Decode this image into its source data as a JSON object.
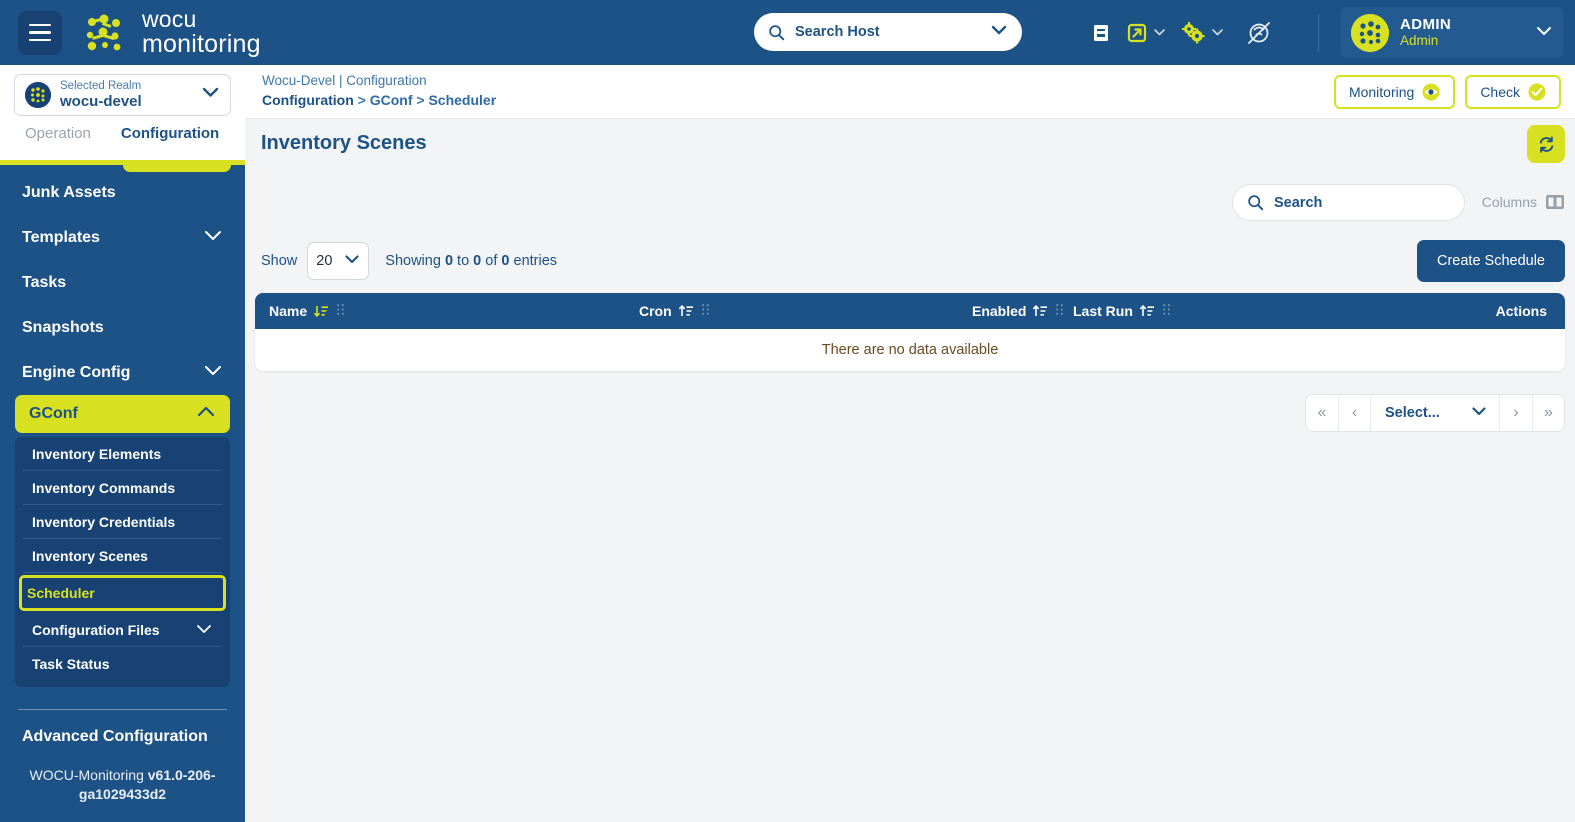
{
  "header": {
    "menu_icon": "hamburger-icon",
    "brand_line1": "wocu",
    "brand_line2": "monitoring",
    "search_host": {
      "placeholder": "Search Host",
      "value": "Search Host",
      "icon": "search-icon"
    },
    "icons": [
      {
        "name": "docs-icon",
        "label": "Documentation"
      },
      {
        "name": "external-link-icon",
        "label": "External Links"
      },
      {
        "name": "gears-icon",
        "label": "Settings"
      },
      {
        "name": "disabled-notifications-icon",
        "label": "Notifications Muted"
      }
    ],
    "user": {
      "name": "ADMIN",
      "role": "Admin",
      "avatar": "wocu-avatar-icon"
    }
  },
  "breadcrumb": {
    "context": "Wocu-Devel | Configuration",
    "path_root": "Configuration",
    "path_mid": "GConf",
    "path_leaf": "Scheduler",
    "separator": ">"
  },
  "top_actions": [
    {
      "label": "Monitoring",
      "icon": "eye-icon"
    },
    {
      "label": "Check",
      "icon": "check-circle-icon"
    }
  ],
  "sidebar": {
    "realm": {
      "caption": "Selected Realm",
      "value": "wocu-devel",
      "icon": "realm-icon"
    },
    "tabs": [
      {
        "label": "Operation",
        "active": false
      },
      {
        "label": "Configuration",
        "active": true
      }
    ],
    "items": [
      {
        "label": "Junk Assets",
        "expandable": false
      },
      {
        "label": "Templates",
        "expandable": true,
        "chevron": "chevron-down-icon"
      },
      {
        "label": "Tasks",
        "expandable": false
      },
      {
        "label": "Snapshots",
        "expandable": false
      },
      {
        "label": "Engine Config",
        "expandable": true,
        "chevron": "chevron-down-icon"
      },
      {
        "label": "GConf",
        "expandable": true,
        "active": true,
        "chevron": "chevron-up-icon"
      }
    ],
    "submenu": [
      {
        "label": "Inventory Elements",
        "selected": false
      },
      {
        "label": "Inventory Commands",
        "selected": false
      },
      {
        "label": "Inventory Credentials",
        "selected": false
      },
      {
        "label": "Inventory Scenes",
        "selected": false
      },
      {
        "label": "Scheduler",
        "selected": true
      },
      {
        "label": "Configuration Files",
        "selected": false,
        "expandable": true
      },
      {
        "label": "Task Status",
        "selected": false
      }
    ],
    "advanced_configuration": "Advanced Configuration",
    "version_prefix": "WOCU-Monitoring ",
    "version_number": "v61.0-206-ga1029433d2"
  },
  "main": {
    "page_title": "Inventory Scenes",
    "refresh_icon": "refresh-icon",
    "search": {
      "placeholder": "Search",
      "value": "Search",
      "icon": "search-icon"
    },
    "columns_label": "Columns",
    "columns_icon": "columns-icon",
    "show_label": "Show",
    "page_size": "20",
    "page_size_options": [
      "20"
    ],
    "showing_text_pre": "Showing ",
    "showing_from": "0",
    "showing_mid1": " to ",
    "showing_to": "0",
    "showing_mid2": " of ",
    "showing_total": "0",
    "showing_suffix": " entries",
    "create_button": "Create Schedule",
    "table": {
      "columns": [
        {
          "label": "Name",
          "sort": "desc",
          "sort_icon": "sort-desc-icon",
          "grip": "drag-grip-icon"
        },
        {
          "label": "Cron",
          "sort": "asc",
          "sort_icon": "sort-asc-icon",
          "grip": "drag-grip-icon"
        },
        {
          "label": "Enabled",
          "sort": "asc",
          "sort_icon": "sort-asc-icon",
          "grip": "drag-grip-icon"
        },
        {
          "label": "Last Run",
          "sort": "asc",
          "sort_icon": "sort-asc-icon",
          "grip": "drag-grip-icon"
        },
        {
          "label": "Actions",
          "sort": "none"
        }
      ],
      "rows": [],
      "empty_message": "There are no data available"
    },
    "pagination": {
      "first": "«",
      "prev": "‹",
      "select_label": "Select...",
      "next": "›",
      "last": "»"
    }
  },
  "colors": {
    "brand_blue": "#1d5286",
    "dark_blue": "#174273",
    "lime": "#d7e021",
    "page_bg": "#f2f4f6",
    "empty_text": "#6b4a22"
  }
}
